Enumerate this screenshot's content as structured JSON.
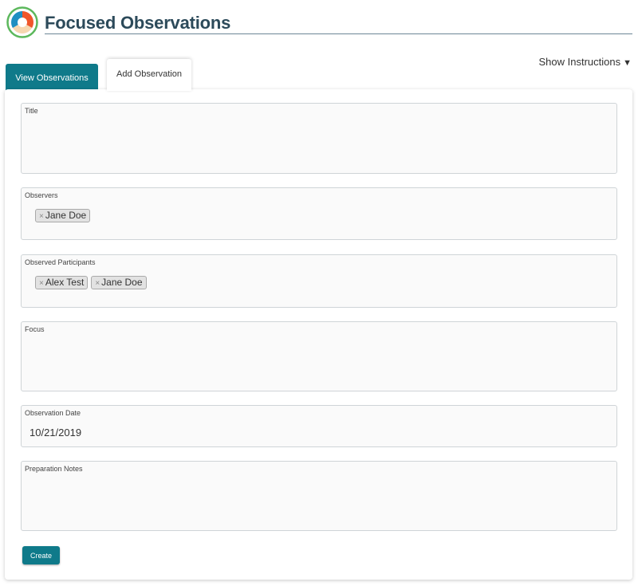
{
  "header": {
    "title": "Focused Observations",
    "logo_icon": "tri-color-circle-logo",
    "colors": {
      "title": "#2c4a5a",
      "teal": "#0f7a8a",
      "logo_green": "#5cb85c",
      "logo_orange": "#f0562b",
      "logo_blue": "#1f8fc2"
    }
  },
  "instructions": {
    "label": "Show Instructions",
    "caret": "▼"
  },
  "tabs": [
    {
      "label": "View Observations",
      "active": false
    },
    {
      "label": "Add Observation",
      "active": true
    }
  ],
  "form": {
    "title": {
      "label": "Title",
      "value": ""
    },
    "observers": {
      "label": "Observers",
      "tags": [
        "Jane Doe"
      ]
    },
    "participants": {
      "label": "Observed Participants",
      "tags": [
        "Alex Test",
        "Jane Doe"
      ]
    },
    "focus": {
      "label": "Focus",
      "value": ""
    },
    "date": {
      "label": "Observation Date",
      "value": "10/21/2019"
    },
    "notes": {
      "label": "Preparation Notes",
      "value": ""
    },
    "tag_remove": "×",
    "create_label": "Create"
  }
}
